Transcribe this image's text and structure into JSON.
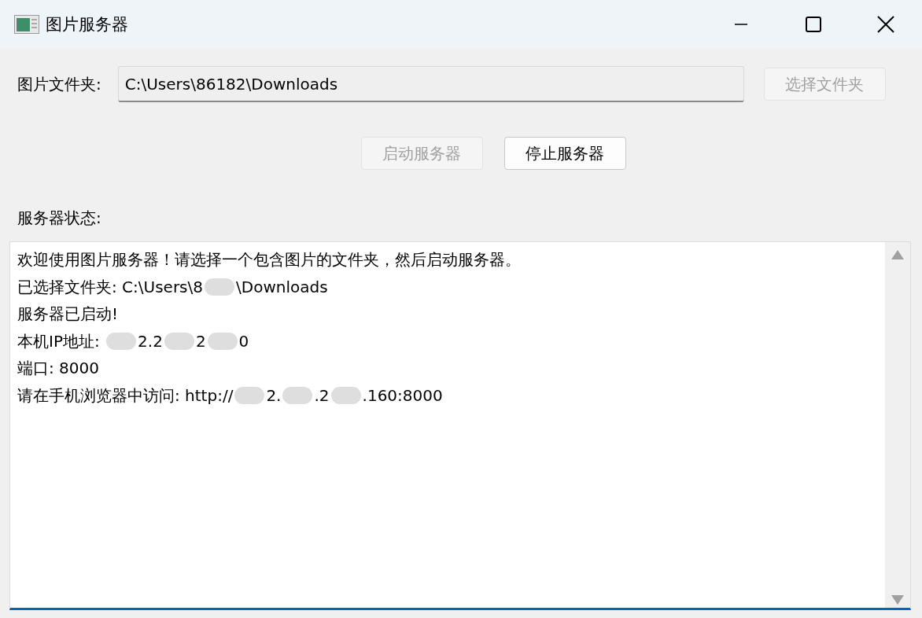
{
  "window": {
    "title": "图片服务器"
  },
  "folder": {
    "label": "图片文件夹:",
    "value": "C:\\Users\\86182\\Downloads",
    "browse_button": {
      "label": "选择文件夹",
      "disabled": true
    }
  },
  "actions": [
    {
      "label": "启动服务器",
      "disabled": true
    },
    {
      "label": "停止服务器",
      "disabled": false
    }
  ],
  "status": {
    "label": "服务器状态:",
    "lines": [
      [
        {
          "text": "欢迎使用图片服务器！请选择一个包含图片的文件夹，然后启动服务器。"
        }
      ],
      [
        {
          "text": "已选择文件夹: C:\\Users\\8"
        },
        {
          "kind": "redacted"
        },
        {
          "text": "\\Downloads"
        }
      ],
      [
        {
          "text": "服务器已启动!"
        }
      ],
      [
        {
          "text": "本机IP地址: "
        },
        {
          "kind": "redacted"
        },
        {
          "text": "2.2"
        },
        {
          "kind": "redacted"
        },
        {
          "text": "2"
        },
        {
          "kind": "redacted"
        },
        {
          "text": "0"
        }
      ],
      [
        {
          "text": "端口: 8000"
        }
      ],
      [
        {
          "text": "请在手机浏览器中访问: http://"
        },
        {
          "kind": "redacted"
        },
        {
          "text": "2."
        },
        {
          "kind": "redacted"
        },
        {
          "text": ".2"
        },
        {
          "kind": "redacted"
        },
        {
          "text": ".160:8000"
        }
      ]
    ]
  }
}
